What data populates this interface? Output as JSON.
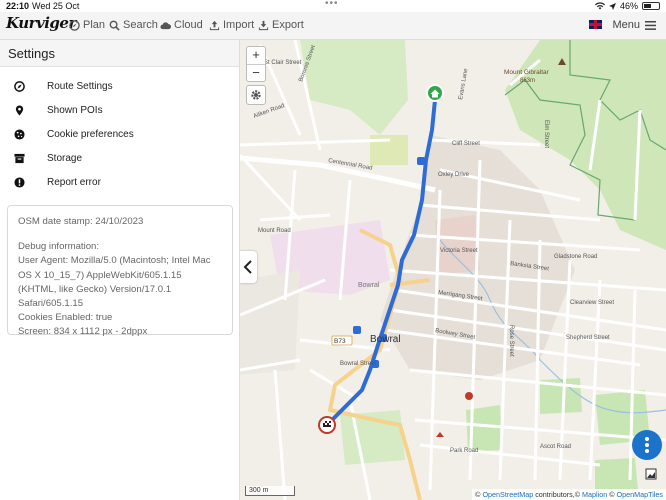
{
  "statusbar": {
    "time": "22:10",
    "date": "Wed 25 Oct",
    "battery": "46%",
    "battery_level": 0.46
  },
  "app": {
    "logo": "Kurviger",
    "nav": [
      {
        "label": "Plan",
        "icon": "compass-icon"
      },
      {
        "label": "Search",
        "icon": "search-icon"
      },
      {
        "label": "Cloud",
        "icon": "cloud-icon"
      },
      {
        "label": "Import",
        "icon": "upload-icon"
      },
      {
        "label": "Export",
        "icon": "download-icon"
      }
    ],
    "menu_label": "Menu"
  },
  "sidebar": {
    "title": "Settings",
    "items": [
      {
        "label": "Route Settings",
        "icon": "route-icon"
      },
      {
        "label": "Shown POIs",
        "icon": "map-pin-icon"
      },
      {
        "label": "Cookie preferences",
        "icon": "cookie-icon"
      },
      {
        "label": "Storage",
        "icon": "archive-icon"
      },
      {
        "label": "Report error",
        "icon": "alert-icon"
      }
    ],
    "info": {
      "osm_stamp": "OSM date stamp: 24/10/2023",
      "debug_title": "Debug information:",
      "user_agent": "User Agent: Mozilla/5.0 (Macintosh; Intel Mac OS X 10_15_7) AppleWebKit/605.1.15 (KHTML, like Gecko) Version/17.0.1 Safari/605.1.15",
      "cookies": "Cookies Enabled: true",
      "screen": "Screen: 834 x 1112 px - 2dppx"
    }
  },
  "map": {
    "zoom_in": "+",
    "zoom_out": "−",
    "scale": "300 m",
    "attribution_prefix": "© ",
    "attribution_osm": "OpenStreetMap",
    "attribution_mid": " contributors,© ",
    "attribution_maplion": "Maplion",
    "attribution_sep": " © ",
    "attribution_omt": "OpenMapTiles",
    "labels": {
      "bowral_center": "Bowral",
      "bowral_town": "Bowral",
      "mount_gibraltar": "Mount Gibraltar",
      "elevation": "863m",
      "road_b73": "B73",
      "st_clair": "St Clair Street",
      "boronia": "Boronia Street",
      "aitken": "Aitken Road",
      "centennial": "Centennial Road",
      "cliff": "Cliff Street",
      "oxley": "Oxley Drive",
      "mount_road": "Mount Road",
      "gladstone": "Gladstone Road",
      "banksia": "Banksia Street",
      "merrigang": "Merrigang Street",
      "shepherd": "Shepherd Street",
      "bowral_street": "Bowral Street",
      "park_road": "Park Road",
      "ascot": "Ascot Road",
      "clearview": "Clearview Street",
      "evans": "Evans Lane",
      "elm": "Elm Street",
      "boolwey": "Boolwey Street",
      "rose": "Rose Street",
      "victoria": "Victoria Street"
    }
  },
  "colors": {
    "route": "#2f6bd6",
    "fab": "#1b74c9",
    "park": "#c8e6b3",
    "road_major": "#f6d28c"
  }
}
